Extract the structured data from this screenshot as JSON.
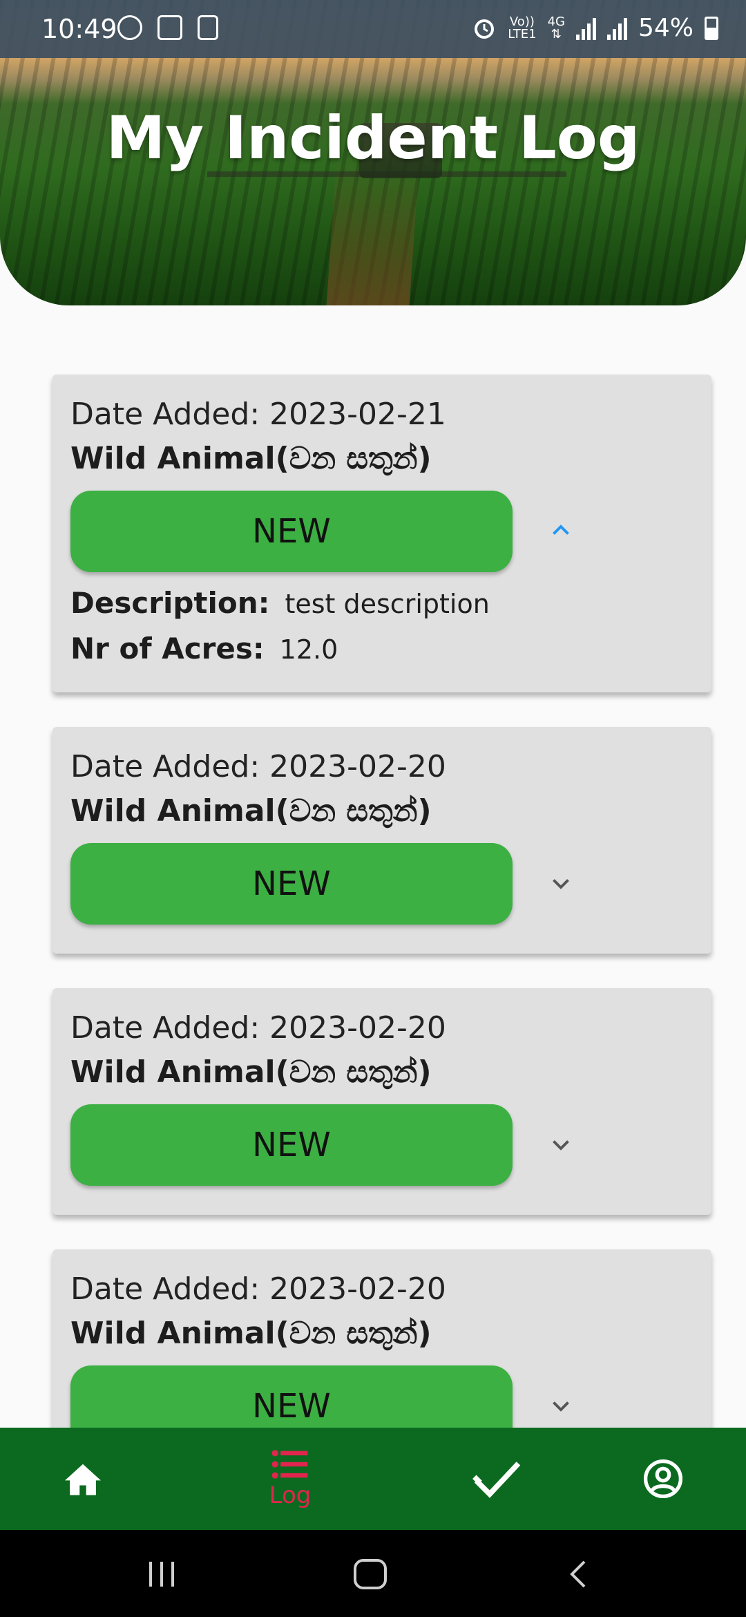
{
  "status_bar": {
    "time": "10:49",
    "network_label_top": "Vo))",
    "network_label_bottom": "LTE1",
    "network_type": "4G",
    "battery": "54%"
  },
  "header": {
    "title": "My Incident Log"
  },
  "incidents": [
    {
      "date_text": "Date Added: 2023-02-21",
      "type": "Wild Animal(වන සතුන්)",
      "status": "NEW",
      "expanded": true,
      "description_label": "Description:",
      "description": "test description",
      "acres_label": "Nr of Acres:",
      "acres": "12.0"
    },
    {
      "date_text": "Date Added: 2023-02-20",
      "type": "Wild Animal(වන සතුන්)",
      "status": "NEW",
      "expanded": false
    },
    {
      "date_text": "Date Added: 2023-02-20",
      "type": "Wild Animal(වන සතුන්)",
      "status": "NEW",
      "expanded": false
    },
    {
      "date_text": "Date Added: 2023-02-20",
      "type": "Wild Animal(වන සතුන්)",
      "status": "NEW",
      "expanded": false
    }
  ],
  "bottom_nav": {
    "items": [
      {
        "icon": "home-icon",
        "label": "",
        "active": false
      },
      {
        "icon": "list-icon",
        "label": "Log",
        "active": true
      },
      {
        "icon": "check-icon",
        "label": "",
        "active": false
      },
      {
        "icon": "profile-icon",
        "label": "",
        "active": false
      }
    ],
    "active_color": "#e0254e",
    "background": "#0b6a1f"
  },
  "colors": {
    "status_green": "#3cb043",
    "card_bg": "#e0e0e0",
    "chevron_active": "#2196f3"
  }
}
